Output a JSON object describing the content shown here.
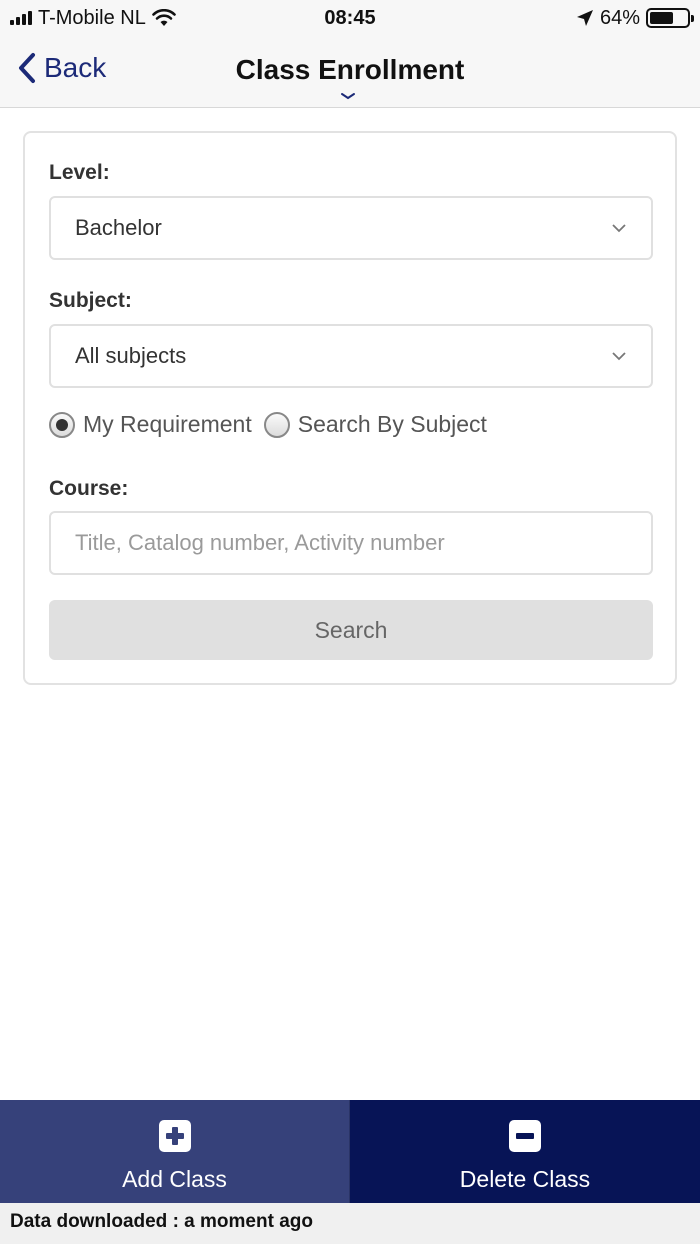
{
  "status_bar": {
    "carrier": "T-Mobile NL",
    "time": "08:45",
    "battery": "64%",
    "battery_level": 0.64
  },
  "nav": {
    "back_label": "Back",
    "title": "Class Enrollment"
  },
  "form": {
    "level_label": "Level:",
    "level_value": "Bachelor",
    "subject_label": "Subject:",
    "subject_value": "All subjects",
    "radio_options": [
      {
        "label": "My Requirement",
        "selected": true
      },
      {
        "label": "Search By Subject",
        "selected": false
      }
    ],
    "course_label": "Course:",
    "course_placeholder": "Title, Catalog number, Activity number",
    "course_value": "",
    "search_label": "Search"
  },
  "bottom_tabs": {
    "add_label": "Add Class",
    "delete_label": "Delete Class"
  },
  "footer": {
    "status_text": "Data downloaded : a moment ago"
  },
  "colors": {
    "accent": "#1c2a78",
    "add_tab": "#36417a",
    "delete_tab": "#071456"
  }
}
